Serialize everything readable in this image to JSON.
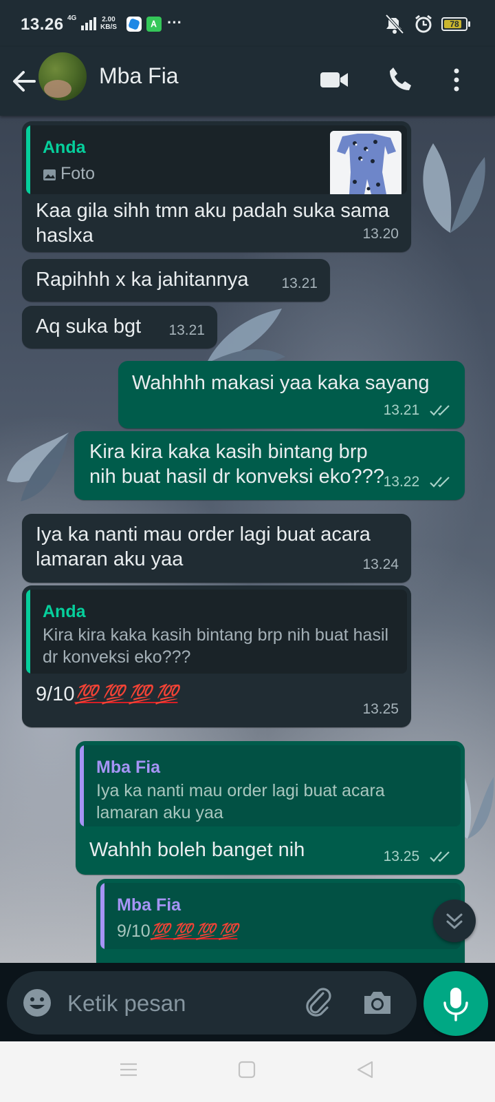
{
  "status_bar": {
    "time": "13.26",
    "network": "4G",
    "speed_value": "2.00",
    "speed_unit": "KB/S",
    "app_icon_2": "Ꭺ",
    "more": "···",
    "battery_level": "78",
    "icons": [
      "mute-icon",
      "alarm-icon",
      "battery-icon"
    ]
  },
  "header": {
    "contact_name": "Mba Fia",
    "icons": [
      "back-arrow-icon",
      "video-call-icon",
      "voice-call-icon",
      "more-vert-icon"
    ]
  },
  "messages": [
    {
      "direction": "in",
      "quote": {
        "name": "Anda",
        "name_color": "#06cf9c",
        "media_label": "Foto",
        "media_icon": "image-icon"
      },
      "text": "Kaa gila sihh tmn aku padah suka sama haslxa",
      "time": "13.20"
    },
    {
      "direction": "in",
      "text": "Rapihhh x ka jahitannya",
      "time": "13.21"
    },
    {
      "direction": "in",
      "text": "Aq suka bgt",
      "time": "13.21"
    },
    {
      "direction": "out",
      "text": "Wahhhh makasi yaa kaka sayang",
      "time": "13.21",
      "status": "read"
    },
    {
      "direction": "out",
      "text": "Kira kira kaka kasih bintang brp nih buat hasil dr konveksi eko???",
      "time": "13.22",
      "status": "read"
    },
    {
      "direction": "in",
      "text": "Iya ka nanti mau order lagi buat acara lamaran aku yaa",
      "time": "13.24"
    },
    {
      "direction": "in",
      "quote": {
        "name": "Anda",
        "name_color": "#06cf9c",
        "text": "Kira kira kaka kasih bintang brp nih buat hasil dr konveksi eko???"
      },
      "text": "9/10",
      "emoji": "💯 💯 💯 💯",
      "time": "13.25"
    },
    {
      "direction": "out",
      "quote": {
        "name": "Mba Fia",
        "name_color": "#a694f5",
        "text": "Iya ka nanti mau order lagi buat acara lamaran aku yaa"
      },
      "text": "Wahhh boleh banget nih",
      "time": "13.25",
      "status": "read"
    },
    {
      "direction": "out",
      "quote": {
        "name": "Mba Fia",
        "name_color": "#a694f5",
        "text": "9/10",
        "emoji": "💯 💯 💯 💯"
      }
    }
  ],
  "composer": {
    "placeholder": "Ketik pesan",
    "icons": [
      "emoji-icon",
      "attach-icon",
      "camera-icon",
      "mic-icon"
    ]
  },
  "colors": {
    "header_bg": "#1f2c34",
    "incoming_bubble": "#202c33",
    "outgoing_bubble": "#005c4b",
    "accent": "#00a884"
  }
}
